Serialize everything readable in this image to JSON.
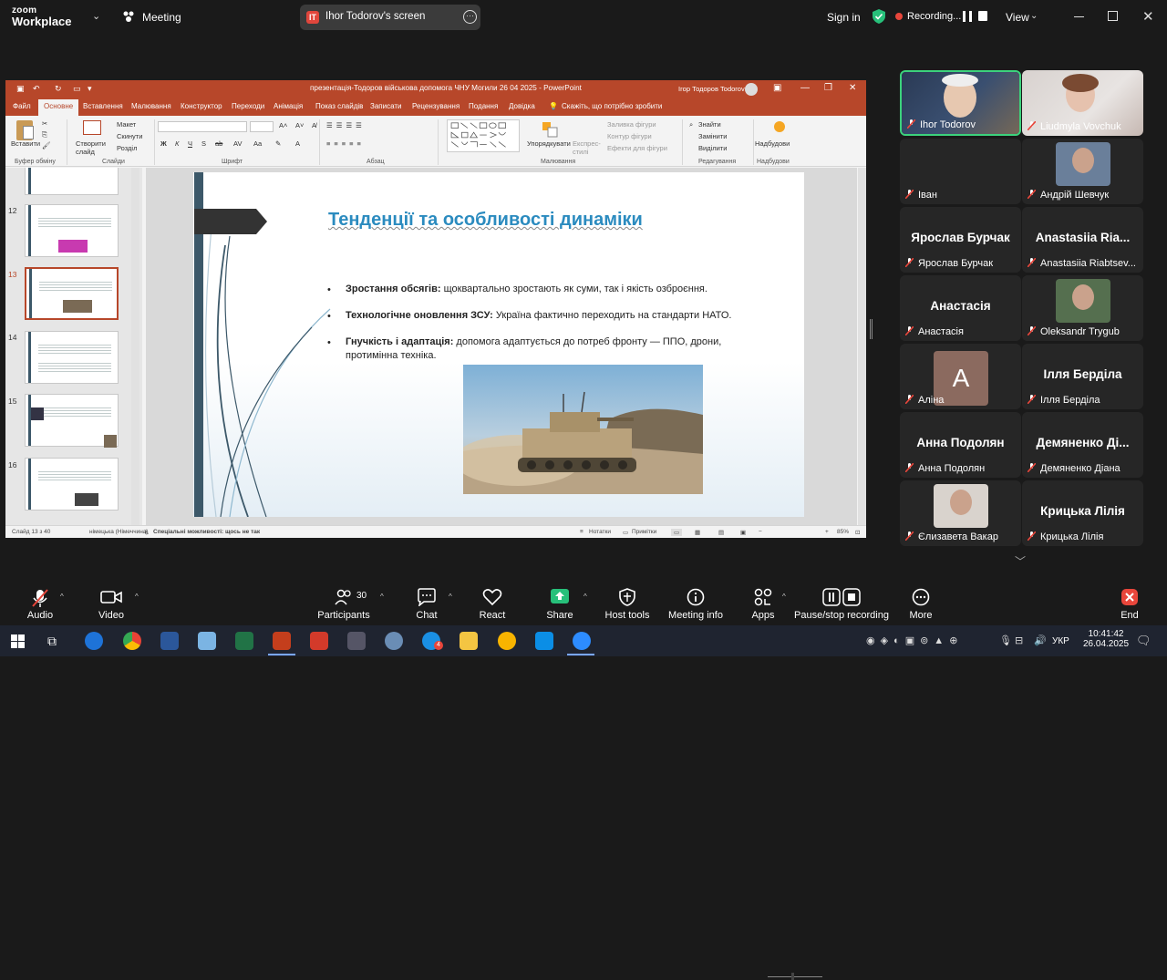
{
  "zoom": {
    "brand_top": "zoom",
    "brand_bottom": "Workplace",
    "meeting_label": "Meeting",
    "screen_share_badge": "IT",
    "screen_share_label": "Ihor Todorov's screen",
    "sign_in": "Sign in",
    "recording_label": "Recording...",
    "view_label": "View"
  },
  "ppt": {
    "title": "презентація-Тодоров військова допомога ЧНУ Могили 26 04 2025  -  PowerPoint",
    "user": "Ігор Тодоров Todorov",
    "tabs": [
      "Файл",
      "Основне",
      "Вставлення",
      "Малювання",
      "Конструктор",
      "Переходи",
      "Анімація",
      "Показ слайдів",
      "Записати",
      "Рецензування",
      "Подання",
      "Довідка"
    ],
    "tell_me": "Скажіть, що потрібно зробити",
    "ribbon": {
      "paste": "Вставити",
      "new_slide": "Створити слайд",
      "layout": "Макет",
      "reset": "Скинути",
      "section": "Розділ",
      "arrange": "Упорядкувати",
      "quick_styles": "Експрес-стилі",
      "shape_fill": "Заливка фігури",
      "shape_outline": "Контур фігури",
      "shape_effects": "Ефекти для фігури",
      "find": "Знайти",
      "replace": "Замінити",
      "select": "Виділити",
      "addins": "Надбудови",
      "groups": [
        "Буфер обміну",
        "Слайди",
        "Шрифт",
        "Абзац",
        "Малювання",
        "Редагування",
        "Надбудови"
      ]
    },
    "slide_numbers": [
      "12",
      "13",
      "14",
      "15",
      "16"
    ],
    "slide": {
      "title": "Тенденції та особливості динаміки",
      "bullets": [
        {
          "bold": "Зростання обсягів:",
          "text": " щоквартально зростають як суми, так і якість озброєння."
        },
        {
          "bold": "Технологічне оновлення ЗСУ:",
          "text": " Україна фактично переходить на стандарти НАТО."
        },
        {
          "bold": "Гнучкість і адаптація:",
          "text": " допомога адаптується до потреб фронту — ППО, дрони, протимінна техніка."
        }
      ]
    },
    "status": {
      "slide_count": "Слайд 13 з 40",
      "language": "німецька (Німеччина)",
      "accessibility": "Спеціальні можливості: щось не так",
      "notes": "Нотатки",
      "comments": "Примітки",
      "zoom": "85%"
    }
  },
  "participants": [
    {
      "name": "Ihor Todorov",
      "big": "",
      "type": "video",
      "active": true
    },
    {
      "name": "Liudmyla Vovchuk",
      "big": "",
      "type": "video",
      "active": false
    },
    {
      "name": "Іван",
      "big": "",
      "type": "blank",
      "active": false
    },
    {
      "name": "Андрій Шевчук",
      "big": "",
      "type": "photo",
      "active": false
    },
    {
      "name": "Ярослав Бурчак",
      "big": "Ярослав Бурчак",
      "type": "text",
      "active": false
    },
    {
      "name": "Anastasiia Riabtsev...",
      "big": "Anastasiia Ria...",
      "type": "text",
      "active": false
    },
    {
      "name": "Анастасія",
      "big": "Анастасія",
      "type": "text",
      "active": false
    },
    {
      "name": "Oleksandr Trygub",
      "big": "",
      "type": "photo",
      "active": false
    },
    {
      "name": "Аліна",
      "big": "A",
      "type": "avatar",
      "active": false
    },
    {
      "name": "Ілля Берділа",
      "big": "Ілля Берділа",
      "type": "text",
      "active": false
    },
    {
      "name": "Анна Подолян",
      "big": "Анна Подолян",
      "type": "text",
      "active": false
    },
    {
      "name": "Демяненко Діана",
      "big": "Демяненко Ді...",
      "type": "text",
      "active": false
    },
    {
      "name": "Єлизавета Вакар",
      "big": "",
      "type": "photo",
      "active": false
    },
    {
      "name": "Крицька Лілія",
      "big": "Крицька Лілія",
      "type": "text",
      "active": false
    }
  ],
  "toolbar": {
    "audio": "Audio",
    "video": "Video",
    "participants": "Participants",
    "participants_count": "30",
    "chat": "Chat",
    "react": "React",
    "share": "Share",
    "host_tools": "Host tools",
    "meeting_info": "Meeting info",
    "apps": "Apps",
    "pause_stop": "Pause/stop recording",
    "more": "More",
    "end": "End"
  },
  "taskbar": {
    "lang": "УКР",
    "time": "10:41:42",
    "date": "26.04.2025",
    "badge_count": "4"
  },
  "colors": {
    "ppt_accent": "#b7472a",
    "active_speaker": "#3cd27c",
    "share_green": "#27c07a",
    "recording_red": "#e8463b"
  }
}
